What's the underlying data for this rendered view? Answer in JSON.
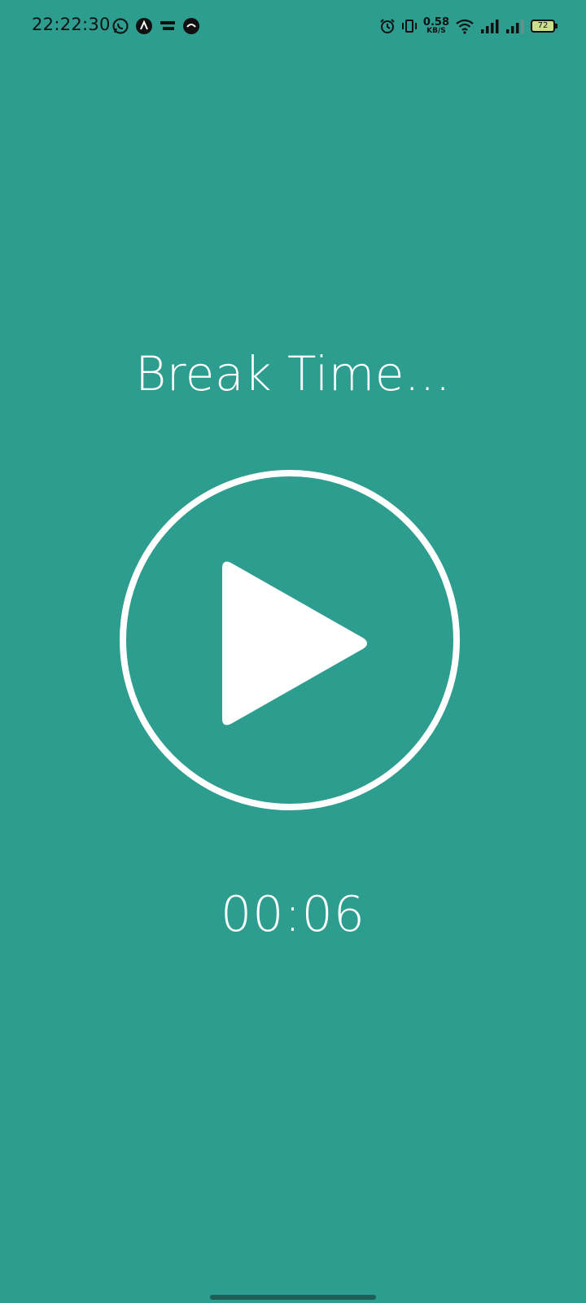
{
  "status_bar": {
    "time": "22:22:30",
    "left_icons": [
      "whatsapp-icon",
      "app-a-icon",
      "globoplay-icon",
      "app-logo-icon"
    ],
    "net_speed_value": "0.58",
    "net_speed_unit": "KB/S",
    "battery_level": "72"
  },
  "screen": {
    "title": "Break Time...",
    "timer": "00:06"
  },
  "colors": {
    "background": "#2c9d8e",
    "foreground": "#ffffff"
  }
}
